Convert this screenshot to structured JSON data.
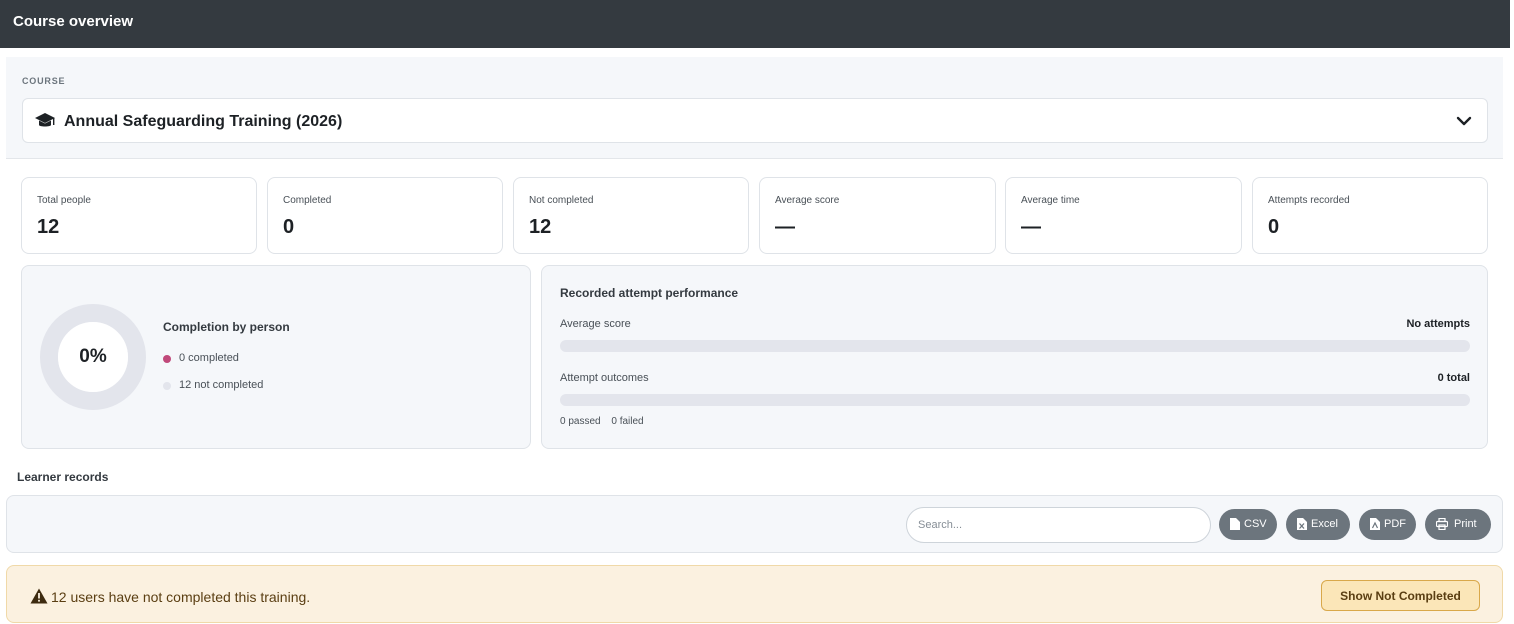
{
  "header": {
    "title": "Course overview"
  },
  "course": {
    "label": "COURSE",
    "selected": "Annual Safeguarding Training (2026)",
    "icon": "graduation-cap-icon"
  },
  "stats": [
    {
      "label": "Total people",
      "value": "12"
    },
    {
      "label": "Completed",
      "value": "0"
    },
    {
      "label": "Not completed",
      "value": "12"
    },
    {
      "label": "Average score",
      "value": "—"
    },
    {
      "label": "Average time",
      "value": "—"
    },
    {
      "label": "Attempts recorded",
      "value": "0"
    }
  ],
  "completion": {
    "percent_text": "0%",
    "completed_fraction": 0,
    "title": "Completion by person",
    "legend": [
      {
        "text": "0 completed",
        "color": "#c0497a"
      },
      {
        "text": "12 not completed",
        "color": "#e3e5ec"
      }
    ]
  },
  "performance": {
    "title": "Recorded attempt performance",
    "rows": [
      {
        "label": "Average score",
        "value": "No attempts",
        "fill_fraction": 0
      },
      {
        "label": "Attempt outcomes",
        "value": "0 total",
        "fill_fraction": 0
      }
    ],
    "passed": "0 passed",
    "failed": "0 failed"
  },
  "learner_records": {
    "title": "Learner records",
    "search_placeholder": "Search...",
    "buttons": [
      {
        "label": "CSV",
        "icon": "file-csv-icon"
      },
      {
        "label": "Excel",
        "icon": "file-excel-icon"
      },
      {
        "label": "PDF",
        "icon": "file-pdf-icon"
      },
      {
        "label": "Print",
        "icon": "print-icon"
      }
    ]
  },
  "alert": {
    "message": "12 users have not completed this training.",
    "button": "Show Not Completed",
    "icon": "warning-icon"
  },
  "colors": {
    "header_bg": "#343a40",
    "accent": "#c0497a",
    "track": "#e3e5ec",
    "button_gray": "#6c757d",
    "warning_bg": "#fbf1e0"
  }
}
